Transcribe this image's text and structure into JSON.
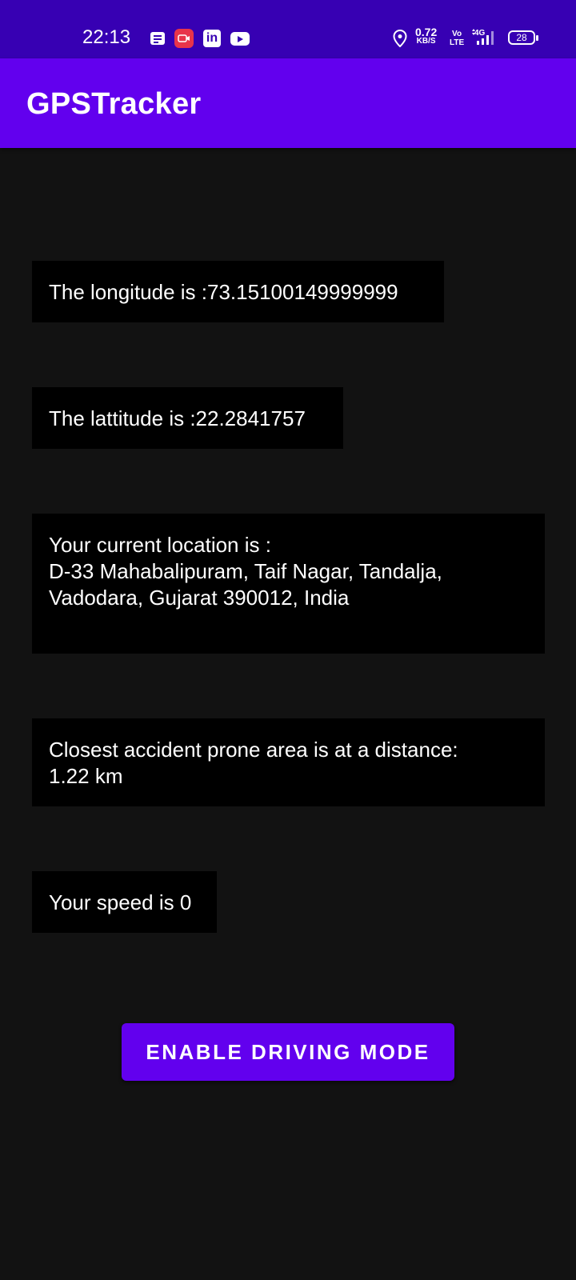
{
  "status_bar": {
    "time": "22:13",
    "net_speed_value": "0.72",
    "net_speed_unit": "KB/S",
    "volte_top": "Vo",
    "volte_bottom": "LTE",
    "network": "4G",
    "battery": "28",
    "icons": [
      "message-icon",
      "screen-record-icon",
      "linkedin-icon",
      "youtube-icon",
      "location-icon",
      "signal-icon",
      "battery-icon"
    ]
  },
  "app_bar": {
    "title": "GPSTracker",
    "color": "#6200ee"
  },
  "cards": {
    "longitude": "The longitude is :73.15100149999999",
    "latitude": "The lattitude is :22.2841757",
    "location_line1": "Your current location is :",
    "location_line2": "D-33 Mahabalipuram, Taif Nagar, Tandalja,",
    "location_line3": "Vadodara, Gujarat 390012, India",
    "accident_line1": "Closest accident prone area is at a distance:",
    "accident_line2": "1.22 km",
    "speed": "Your speed is 0"
  },
  "button": {
    "label": "ENABLE DRIVING MODE"
  }
}
